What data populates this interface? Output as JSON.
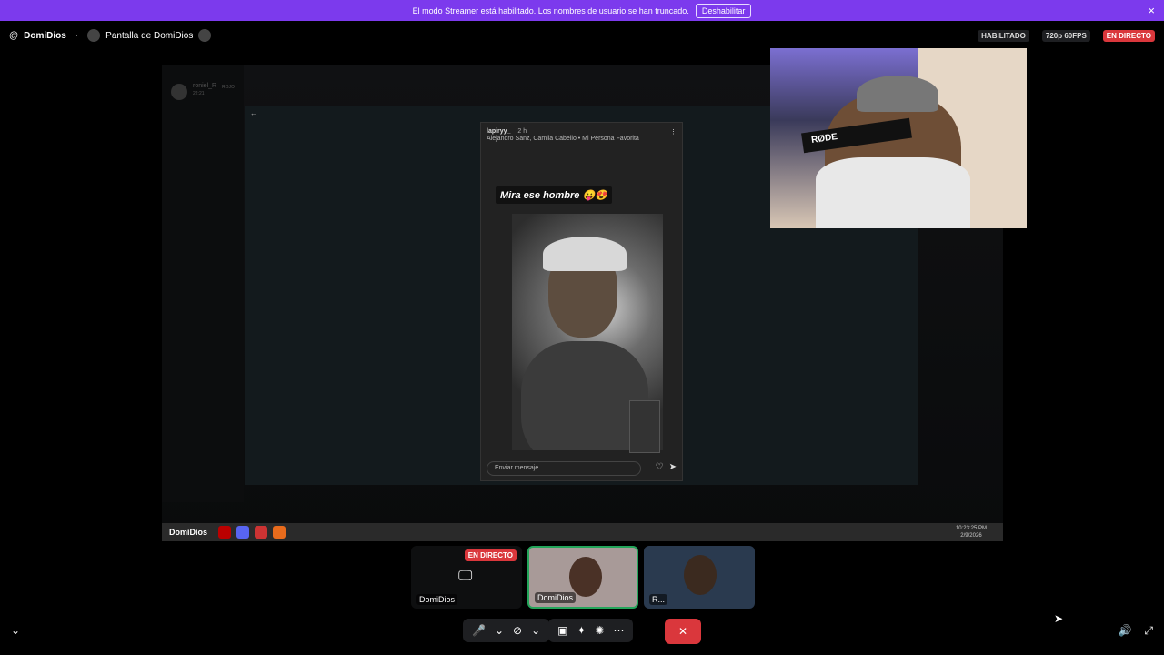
{
  "banner": {
    "text": "El modo Streamer está habilitado. Los nombres de usuario se han truncado.",
    "button": "Deshabilitar",
    "close": "×"
  },
  "topbar": {
    "channel_icon": "@",
    "user": "DomiDios",
    "separator": "·",
    "screen": "Pantalla de DomiDios",
    "pill": "HABILITADO",
    "quality": "720p 60FPS",
    "live": "EN DIRECTO"
  },
  "story": {
    "username": "lapiryy_",
    "time": "2 h",
    "song": "Alejandro Sanz, Camila Cabello • Mi Persona Favorita",
    "caption": "Mira ese hombre 😛😍",
    "message_placeholder": "Enviar mensaje"
  },
  "stage": {
    "faded_user": "roniel_R",
    "faded_badge": "ROJO",
    "faded_time": "22:21"
  },
  "taskbar": {
    "brand": "DomiDios",
    "time": "10:23:25 PM",
    "date": "2/9/2026"
  },
  "webcam": {
    "mic_text": "RØDE"
  },
  "tiles": [
    {
      "label": "DomiDios",
      "badge": "EN DIRECTO"
    },
    {
      "label": "DomiDios"
    },
    {
      "label": "R..."
    }
  ],
  "icons": [
    "mic-icon",
    "chevron-down-icon",
    "camera-off-icon",
    "screen-share-icon",
    "activities-icon",
    "soundboard-icon",
    "more-icon",
    "end-call-icon",
    "volume-icon",
    "fullscreen-icon",
    "collapse-icon"
  ]
}
